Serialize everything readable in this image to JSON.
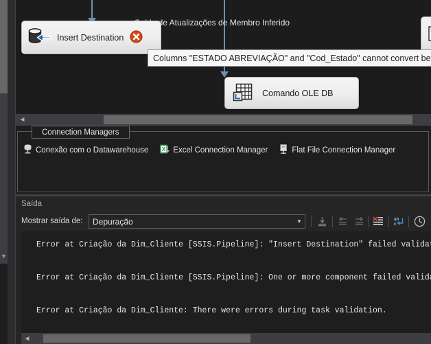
{
  "colors": {
    "accent_arrow": "#6e8fb5",
    "error_badge": "#d14818",
    "canvas_bg": "#1c1c1c",
    "pane_bg": "#252526",
    "output_bg": "#1e1e1e",
    "scrollbar_thumb": "#686868",
    "scrollbar_track": "#3e3e42",
    "component_face": "#eeeeee",
    "tooltip_bg": "#f6f6f6",
    "excel_green": "#2a8a4a"
  },
  "design_surface": {
    "components": [
      {
        "id": "insert-destination",
        "label": "Insert Destination",
        "icon": "ole-db-destination-icon",
        "has_error": true,
        "error_icon": "error-badge-icon"
      },
      {
        "id": "comando-ole-db",
        "label": "Comando OLE DB",
        "icon": "ole-db-command-icon",
        "has_error": false
      }
    ],
    "path_label": "Saída de Atualizações de Membro Inferido",
    "tooltip": {
      "text": "Columns \"ESTADO ABREVIAÇÃO\" and \"Cod_Estado\" cannot convert between",
      "name": "validation-error-tooltip"
    },
    "hscrollbar": {
      "left_arrow": "◄"
    }
  },
  "connection_managers": {
    "tab_label": "Connection Managers",
    "items": [
      {
        "label": "Conexão com o Datawarehouse",
        "icon": "ole-db-connection-icon"
      },
      {
        "label": "Excel Connection Manager",
        "icon": "excel-connection-icon"
      },
      {
        "label": "Flat File Connection Manager",
        "icon": "flat-file-connection-icon"
      }
    ]
  },
  "output": {
    "title": "Saída",
    "source_label": "Mostrar saída de:",
    "source_value": "Depuração",
    "source_placeholder": "Depuração",
    "source_options": [
      "Depuração"
    ],
    "caret": "▼",
    "toolbar_buttons": [
      {
        "name": "go-to-source-button",
        "title": "Ir para a origem"
      },
      {
        "name": "go-to-previous-message-button",
        "title": "Mensagem anterior"
      },
      {
        "name": "go-to-next-message-button",
        "title": "Próxima mensagem"
      },
      {
        "name": "clear-all-button",
        "title": "Limpar tudo"
      },
      {
        "name": "toggle-word-wrap-button",
        "title": "Quebra automática de linha"
      },
      {
        "name": "toggle-timestamps-button",
        "title": "Mostrar carimbos de data/hora"
      }
    ],
    "lines": [
      "Error at Criação da Dim_Cliente [SSIS.Pipeline]: \"Insert Destination\" failed validati",
      "Error at Criação da Dim_Cliente [SSIS.Pipeline]: One or more component failed validat",
      "Error at Criação da Dim_Cliente: There were errors during task validation."
    ],
    "hscrollbar": {
      "left_arrow": "◄"
    }
  },
  "outer_scrollbar": {
    "down_arrow": "▼"
  }
}
